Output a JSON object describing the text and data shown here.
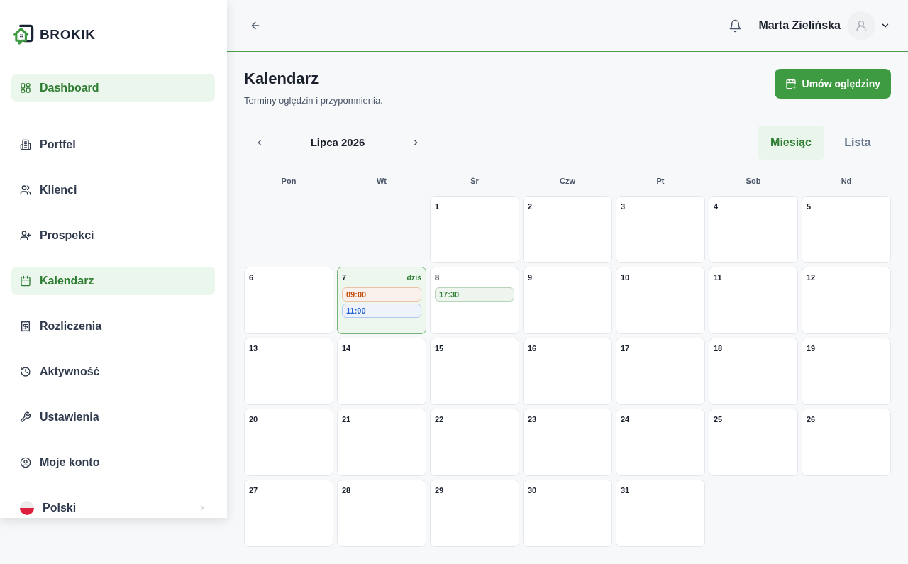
{
  "sidebar": {
    "brand": "BROKIK",
    "nav_groups": [
      [
        {
          "label": "Dashboard",
          "selected": true
        }
      ],
      [
        {
          "label": "Portfel",
          "selected": false
        },
        {
          "label": "Klienci",
          "selected": false
        },
        {
          "label": "Prospekci",
          "selected": false
        },
        {
          "label": "Kalendarz",
          "selected": true
        },
        {
          "label": "Rozliczenia",
          "selected": false
        },
        {
          "label": "Aktywność",
          "selected": false
        },
        {
          "label": "Ustawienia",
          "selected": false
        },
        {
          "label": "Moje konto",
          "selected": false
        }
      ]
    ],
    "language": {
      "label": "Polski"
    }
  },
  "header": {
    "user_name": "Marta Zielińska"
  },
  "page": {
    "title": "Kalendarz",
    "subtitle": "Terminy oględzin i przypomnienia.",
    "primary_action": "Umów oględziny"
  },
  "calendar": {
    "month_label": "Lipca 2026",
    "views": [
      {
        "label": "Miesiąc",
        "selected": true
      },
      {
        "label": "Lista",
        "selected": false
      }
    ],
    "weekdays": [
      "Pon",
      "Wt",
      "Śr",
      "Czw",
      "Pt",
      "Sob",
      "Nd"
    ],
    "weeks": [
      [
        {
          "kind": "blank"
        },
        {
          "kind": "blank"
        },
        {
          "kind": "day",
          "number": "1",
          "today": false
        },
        {
          "kind": "day",
          "number": "2",
          "today": false
        },
        {
          "kind": "day",
          "number": "3",
          "today": false
        },
        {
          "kind": "day",
          "number": "4",
          "today": false
        },
        {
          "kind": "day",
          "number": "5",
          "today": false
        }
      ],
      [
        {
          "kind": "day",
          "number": "6",
          "today": false
        },
        {
          "kind": "day",
          "number": "7",
          "today": true,
          "today_label": "dziś",
          "events": [
            {
              "time": "09:00",
              "color": "#c2500f"
            },
            {
              "time": "11:00",
              "color": "#1f62d0"
            }
          ]
        },
        {
          "kind": "day",
          "number": "8",
          "today": false,
          "events": [
            {
              "time": "17:30",
              "color": "#2e7d32"
            }
          ]
        },
        {
          "kind": "day",
          "number": "9",
          "today": false
        },
        {
          "kind": "day",
          "number": "10",
          "today": false
        },
        {
          "kind": "day",
          "number": "11",
          "today": false
        },
        {
          "kind": "day",
          "number": "12",
          "today": false
        }
      ],
      [
        {
          "kind": "day",
          "number": "13",
          "today": false
        },
        {
          "kind": "day",
          "number": "14",
          "today": false
        },
        {
          "kind": "day",
          "number": "15",
          "today": false
        },
        {
          "kind": "day",
          "number": "16",
          "today": false
        },
        {
          "kind": "day",
          "number": "17",
          "today": false
        },
        {
          "kind": "day",
          "number": "18",
          "today": false
        },
        {
          "kind": "day",
          "number": "19",
          "today": false
        }
      ],
      [
        {
          "kind": "day",
          "number": "20",
          "today": false
        },
        {
          "kind": "day",
          "number": "21",
          "today": false
        },
        {
          "kind": "day",
          "number": "22",
          "today": false
        },
        {
          "kind": "day",
          "number": "23",
          "today": false
        },
        {
          "kind": "day",
          "number": "24",
          "today": false
        },
        {
          "kind": "day",
          "number": "25",
          "today": false
        },
        {
          "kind": "day",
          "number": "26",
          "today": false
        }
      ],
      [
        {
          "kind": "day",
          "number": "27",
          "today": false
        },
        {
          "kind": "day",
          "number": "28",
          "today": false
        },
        {
          "kind": "day",
          "number": "29",
          "today": false
        },
        {
          "kind": "day",
          "number": "30",
          "today": false
        },
        {
          "kind": "day",
          "number": "31",
          "today": false
        }
      ]
    ]
  }
}
